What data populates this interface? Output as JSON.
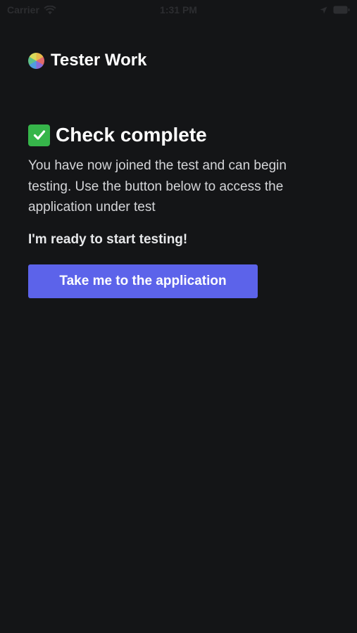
{
  "status_bar": {
    "carrier": "Carrier",
    "time": "1:31 PM",
    "icons": [
      "wifi-icon",
      "location-icon",
      "battery-icon"
    ]
  },
  "brand": {
    "name": "Tester Work",
    "icon": "logo-icon"
  },
  "main": {
    "heading": "Check complete",
    "heading_icon": "check-icon",
    "description": "You have now joined the test and can begin testing. Use the button below to access the application under test",
    "ready_text": "I'm ready to start testing!",
    "cta_label": "Take me to the application"
  },
  "colors": {
    "background": "#141517",
    "accent": "#5c63ea",
    "check": "#36b54a"
  }
}
